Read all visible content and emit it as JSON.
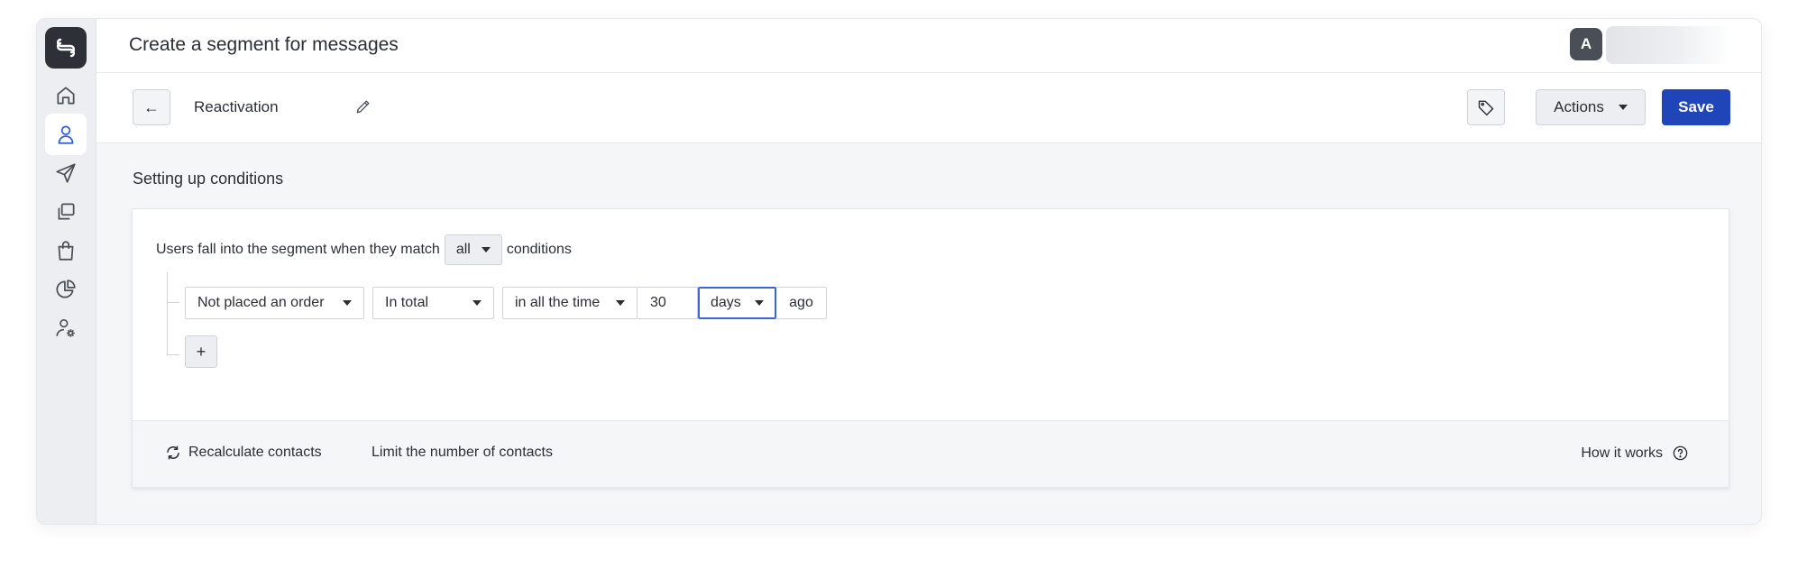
{
  "header": {
    "title": "Create a segment for messages",
    "avatar_letter": "A"
  },
  "toolbar": {
    "back_label": "←",
    "segment_name": "Reactivation",
    "actions_label": "Actions",
    "save_label": "Save"
  },
  "sidebar": {
    "items": [
      {
        "icon": "home-icon"
      },
      {
        "icon": "user-icon",
        "active": true
      },
      {
        "icon": "send-icon"
      },
      {
        "icon": "copy-icon"
      },
      {
        "icon": "shopping-bag-icon"
      },
      {
        "icon": "pie-chart-icon"
      },
      {
        "icon": "user-settings-icon"
      }
    ]
  },
  "main": {
    "section_title": "Setting up conditions",
    "match_prefix": "Users fall into the segment when they match",
    "match_value": "all",
    "match_suffix": "conditions",
    "condition": {
      "event": "Not placed an order",
      "aggregation": "In total",
      "period": "in all the time",
      "amount": "30",
      "unit": "days",
      "suffix": "ago"
    },
    "add_label": "+",
    "footer": {
      "recalculate": "Recalculate contacts",
      "limit": "Limit the number of contacts",
      "how": "How it works"
    }
  },
  "colors": {
    "primary": "#1f45b8",
    "focus": "#3d63d8",
    "active_nav": "#2f5bd3",
    "logo_bg": "#2d3137"
  }
}
